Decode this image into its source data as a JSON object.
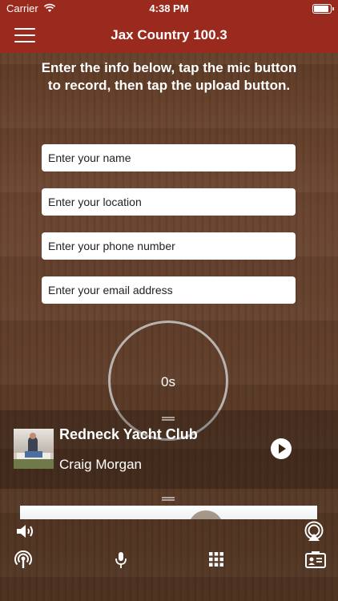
{
  "status_bar": {
    "carrier": "Carrier",
    "time": "4:38 PM"
  },
  "header": {
    "title": "Jax Country 100.3",
    "menu_icon": "hamburger-menu-icon"
  },
  "instructions": "Enter the info below, tap the mic button to record, then tap the upload button.",
  "form": {
    "name_placeholder": "Enter your name",
    "location_placeholder": "Enter your location",
    "phone_placeholder": "Enter your phone number",
    "email_placeholder": "Enter your email address"
  },
  "recorder": {
    "elapsed": "0s"
  },
  "now_playing": {
    "title": "Redneck Yacht Club",
    "artist": "Craig Morgan",
    "play_icon": "play-icon"
  },
  "bottom_bar": {
    "icons": [
      "volume-icon",
      "airplay-icon",
      "podcast-icon",
      "mic-icon",
      "grid-icon",
      "contact-card-icon"
    ]
  },
  "colors": {
    "header_red": "#9b2a1e",
    "wood_brown": "#5e3b24",
    "text_white": "#ffffff"
  }
}
